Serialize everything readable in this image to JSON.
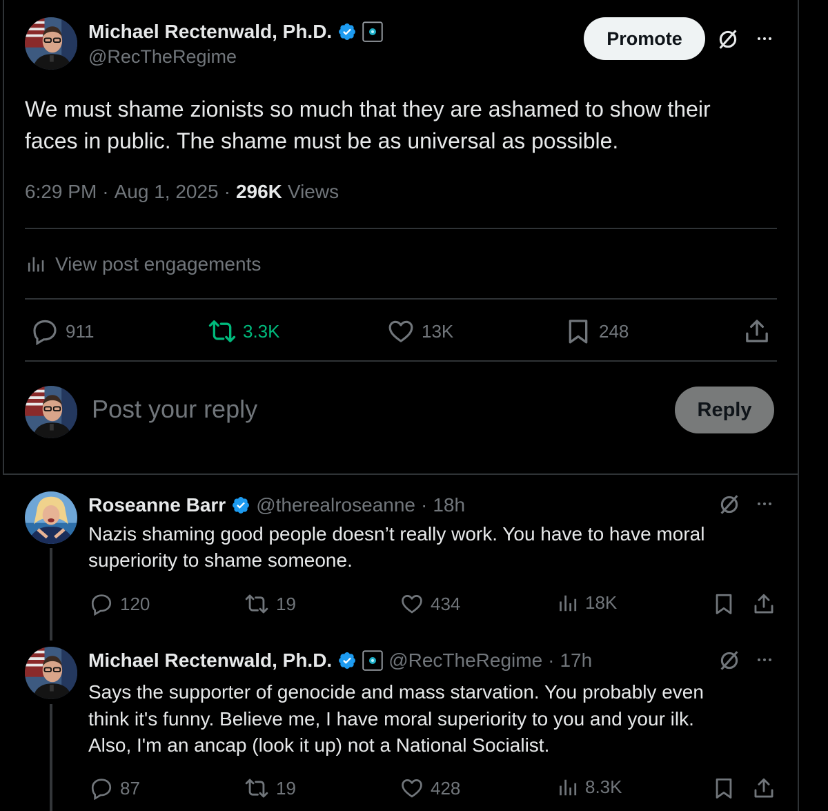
{
  "main_post": {
    "author_name": "Michael Rectenwald, Ph.D.",
    "handle": "@RecTheRegime",
    "promote_label": "Promote",
    "text_line1": "We must shame zionists so much that they are ashamed to show their",
    "text_line2": "faces in public. The shame must be as universal as possible.",
    "time": "6:29 PM",
    "date": "Aug 1, 2025",
    "views_count": "296K",
    "views_label": "Views",
    "engagements_label": "View post engagements",
    "replies": "911",
    "reposts": "3.3K",
    "likes": "13K",
    "bookmarks": "248"
  },
  "reply_composer": {
    "placeholder": "Post your reply",
    "reply_label": "Reply"
  },
  "replies": [
    {
      "author_name": "Roseanne Barr",
      "handle": "@therealroseanne",
      "age": "18h",
      "line1": "Nazis shaming good people doesn’t really work. You have to have moral",
      "line2": "superiority to shame someone.",
      "replies": "120",
      "reposts": "19",
      "likes": "434",
      "views": "18K"
    },
    {
      "author_name": "Michael Rectenwald, Ph.D.",
      "handle": "@RecTheRegime",
      "age": "17h",
      "line1": "Says the supporter of genocide and mass starvation. You probably even",
      "line2": "think it's funny. Believe me, I have moral superiority to you and your ilk.",
      "line3": "Also, I'm an ancap (look it up) not a National Socialist.",
      "replies": "87",
      "reposts": "19",
      "likes": "428",
      "views": "8.3K"
    }
  ],
  "colors": {
    "background": "#000000",
    "text": "#e7e9ea",
    "muted": "#71767b",
    "verified_blue": "#1d9bf0",
    "repost_green": "#00ba7c",
    "divider": "#2f3336"
  }
}
